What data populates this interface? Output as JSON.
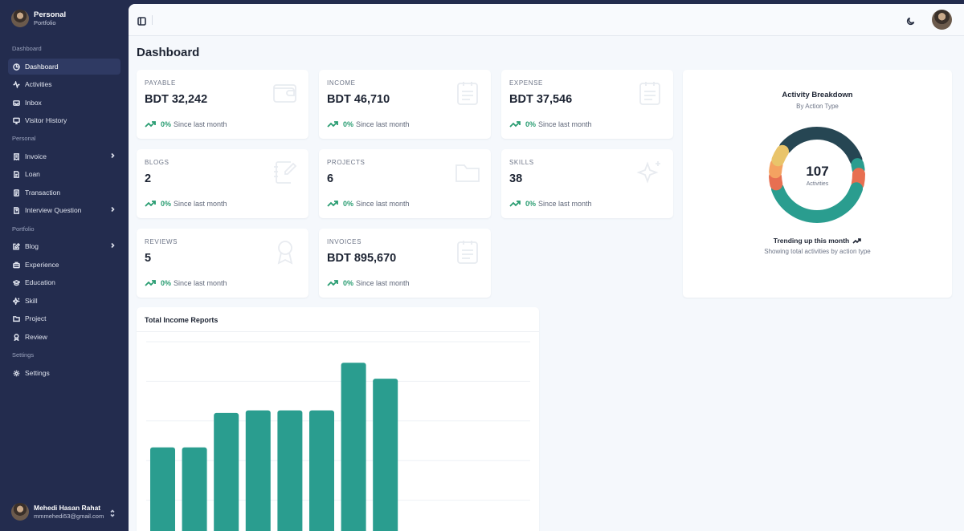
{
  "brand": {
    "title": "Personal",
    "subtitle": "Portfolio"
  },
  "sidebar": {
    "sections": [
      "Dashboard",
      "Personal",
      "Portfolio",
      "Settings"
    ],
    "items": [
      {
        "label": "Dashboard",
        "icon": "dashboard-icon",
        "active": true
      },
      {
        "label": "Activities",
        "icon": "activity-icon"
      },
      {
        "label": "Inbox",
        "icon": "inbox-icon"
      },
      {
        "label": "Visitor History",
        "icon": "monitor-icon"
      },
      {
        "label": "Invoice",
        "icon": "invoice-icon",
        "expandable": true
      },
      {
        "label": "Loan",
        "icon": "loan-icon"
      },
      {
        "label": "Transaction",
        "icon": "transaction-icon"
      },
      {
        "label": "Interview Question",
        "icon": "question-icon",
        "expandable": true
      },
      {
        "label": "Blog",
        "icon": "blog-icon",
        "expandable": true
      },
      {
        "label": "Experience",
        "icon": "briefcase-icon"
      },
      {
        "label": "Education",
        "icon": "graduation-cap-icon"
      },
      {
        "label": "Skill",
        "icon": "sparkle-icon"
      },
      {
        "label": "Project",
        "icon": "folder-icon"
      },
      {
        "label": "Review",
        "icon": "award-icon"
      },
      {
        "label": "Settings",
        "icon": "gear-icon"
      }
    ]
  },
  "user": {
    "name": "Mehedi Hasan Rahat",
    "email": "mmmehedi53@gmail.com"
  },
  "page": {
    "title": "Dashboard"
  },
  "cards": [
    {
      "label": "PAYABLE",
      "value": "BDT 32,242",
      "pct": "0%",
      "since": "Since last month"
    },
    {
      "label": "INCOME",
      "value": "BDT 46,710",
      "pct": "0%",
      "since": "Since last month"
    },
    {
      "label": "EXPENSE",
      "value": "BDT 37,546",
      "pct": "0%",
      "since": "Since last month"
    },
    {
      "label": "BLOGS",
      "value": "2",
      "pct": "0%",
      "since": "Since last month"
    },
    {
      "label": "PROJECTS",
      "value": "6",
      "pct": "0%",
      "since": "Since last month"
    },
    {
      "label": "SKILLS",
      "value": "38",
      "pct": "0%",
      "since": "Since last month"
    },
    {
      "label": "REVIEWS",
      "value": "5",
      "pct": "0%",
      "since": "Since last month"
    },
    {
      "label": "INVOICES",
      "value": "BDT 895,670",
      "pct": "0%",
      "since": "Since last month"
    }
  ],
  "activity": {
    "title": "Activity Breakdown",
    "subtitle": "By Action Type",
    "total": "107",
    "total_label": "Activities",
    "trending": "Trending up this month",
    "showing": "Showing total activities by action type"
  },
  "colors": {
    "accent": "#2a9d8f",
    "trend_green": "#2a9d72",
    "donut": [
      "#264653",
      "#2a9d8f",
      "#e9c46a",
      "#f4a261",
      "#e76f51"
    ]
  },
  "chart_data": [
    {
      "type": "pie",
      "title": "Activity Breakdown",
      "subtitle": "By Action Type",
      "labels": [],
      "values": [
        37,
        4,
        6,
        44,
        5,
        5,
        6
      ],
      "colors": [
        "#264653",
        "#2a9d8f",
        "#e76f51",
        "#2a9d8f",
        "#e76f51",
        "#f4a261",
        "#e9c46a"
      ]
    },
    {
      "type": "bar",
      "title": "Total Income Reports",
      "categories": [],
      "values": [
        35,
        35,
        48,
        49,
        49,
        49,
        67,
        61
      ],
      "ylim": [
        0,
        75
      ],
      "grid": true
    }
  ]
}
